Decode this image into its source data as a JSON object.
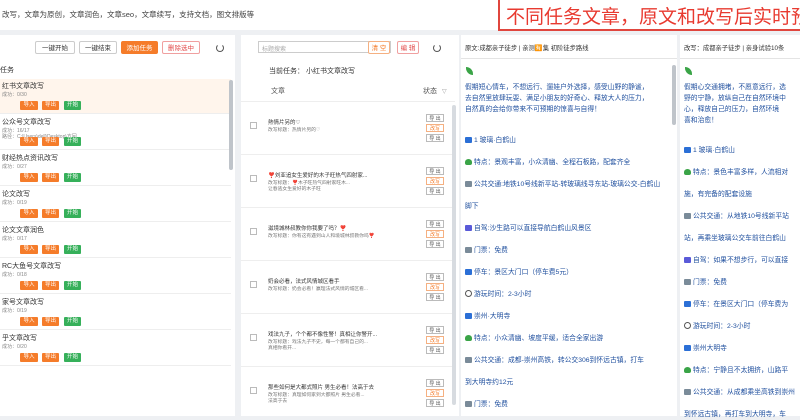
{
  "header": {
    "description": "改写，文章为原创，文章润色，文章seo，文章续写，支持文档，图文排版等",
    "banner": "不同任务文章，原文和改写后实时预"
  },
  "toolbar": {
    "start_all": "一键开始",
    "end_all": "一键结束",
    "add_task": "添加任务",
    "delete_selected": "删除选中"
  },
  "task_list": {
    "header": "任务",
    "import_label": "导入",
    "export_label": "导出",
    "start_label": "开始",
    "items": [
      {
        "title": "红书文章改写",
        "status": "成功：0/30",
        "path": ""
      },
      {
        "title": "公众号文章改写",
        "status": "成功：16/17",
        "path": "路径：C:\\Users\\dell\\Desktop\\方回"
      },
      {
        "title": "财经热点资讯改写",
        "status": "成功：0/27",
        "path": ""
      },
      {
        "title": "论文改写",
        "status": "成功：0/19",
        "path": ""
      },
      {
        "title": "论文文章润色",
        "status": "成功：0/17",
        "path": ""
      },
      {
        "title": "RC大鱼号文章改写",
        "status": "成功：0/18",
        "path": ""
      },
      {
        "title": "家号文章改写",
        "status": "成功：0/19",
        "path": ""
      },
      {
        "title": "乎文章改写",
        "status": "成功：0/20",
        "path": ""
      }
    ]
  },
  "article_list": {
    "search_placeholder": "标题搜索",
    "clear_label": "清 空",
    "edit_label": "编 辑",
    "current_task": "当前任务：  小红书文章改写",
    "col_article": "文章",
    "col_status": "状态",
    "export_label": "导 出",
    "rewrite_label": "改写",
    "items": [
      {
        "title": "熱情片另的♡",
        "sub": "改写标题：热情片另的♡",
        "line": ""
      },
      {
        "title": "❣️刘亚追女生爱好的木子旺热气四射家...",
        "sub": "改写标题：❣️木子旺热气四射家旺木...",
        "line": "让春逃女生爱好的木子旺"
      },
      {
        "title": "滋境城林叔教你你我要了吗？❣️",
        "sub": "改写标题：你有这有遇到山人和境城林叔教你吗❣️",
        "line": ""
      },
      {
        "title": "奶会必看，法式风情城区看手",
        "sub": "改写标题：奶会必看！赢理法式风情的城区看...",
        "line": ""
      },
      {
        "title": "戏法九子，个个都不像性警！真相让你警开...",
        "sub": "改写标题：戏法九子不史，每一个都有自己的...",
        "line": "真相你看开..."
      },
      {
        "title": "那些如何是大都式照片 男生必看！法高于去",
        "sub": "改写标题：真理如何家到大都照片 男生必看...",
        "line": "法高于去"
      }
    ]
  },
  "source_panel": {
    "header": "原文:成都亲子徒步 | 亲测🈶集 初阶徒步路线",
    "intro": [
      "假期短心情车，不想远行、遛娃户外选择，感受山野的静谧，",
      "去自然里放肆玩耍、满足小朋友的好奇心、释放大人的压力，",
      "自然真的会给你带来不可预期的惊喜与自得！"
    ],
    "items": [
      {
        "icon": "blue",
        "text": "1 玻璃·白鹤山"
      },
      {
        "icon": "tree",
        "text": "特点：景观丰富，小众清幽、全程石板路，配套齐全"
      },
      {
        "icon": "gray",
        "text": "公共交通:地铁10号线新平站-转玻璃线寻东站-玻璃公交-白鹤山"
      },
      {
        "icon": "",
        "text": "脚下"
      },
      {
        "icon": "purple",
        "text": "自驾:沙生路可以直接导航白鹤山风景区"
      },
      {
        "icon": "gray",
        "text": "门票：免费"
      },
      {
        "icon": "blue",
        "text": "停车：景区大门口（停车费5元）"
      },
      {
        "icon": "ring",
        "text": "游玩时间：2-3小时"
      },
      {
        "icon": "blue",
        "text": "崇州·大明寺"
      },
      {
        "icon": "tree",
        "text": "特点：小众清幽、坡度平缓，适合全家出游"
      },
      {
        "icon": "gray",
        "text": "公共交通：成都-崇州高铁，转公交306到怀远古镇，打车"
      },
      {
        "icon": "",
        "text": "到大明寺约12元"
      },
      {
        "icon": "gray",
        "text": "门票：免费"
      }
    ]
  },
  "rewrite_panel": {
    "header": "改写：成都亲子徒步 | 亲身试验10条",
    "intro": [
      "假期心交通拥堵，不愿意远行，选",
      "野的宁静，放纵自己在自然环境中",
      "心，释放自己的压力，自然环境",
      "喜和治愈！"
    ],
    "items": [
      {
        "icon": "blue",
        "text": "1 玻璃·白鹤山"
      },
      {
        "icon": "tree",
        "text": "特点：景色丰富多样，人流相对"
      },
      {
        "icon": "",
        "text": "施，有完备的配套设施"
      },
      {
        "icon": "gray",
        "text": "公共交通：从地铁10号线新平站"
      },
      {
        "icon": "",
        "text": "站，再乘坐玻璃公交车前往白鹤山"
      },
      {
        "icon": "purple",
        "text": "自驾：如果不想步行，可以直接"
      },
      {
        "icon": "gray",
        "text": "门票：免费"
      },
      {
        "icon": "blue",
        "text": "停车：在景区大门口（停车费为"
      },
      {
        "icon": "ring",
        "text": "游玩时间：2-3小时"
      },
      {
        "icon": "blue",
        "text": "崇州大明寺"
      },
      {
        "icon": "tree",
        "text": "特点：宁静且不太拥挤，山路平"
      },
      {
        "icon": "gray",
        "text": "公共交通：从成都乘坐高铁到崇州"
      },
      {
        "icon": "",
        "text": "到怀远古镇，再打车到大明寺，车"
      }
    ]
  }
}
